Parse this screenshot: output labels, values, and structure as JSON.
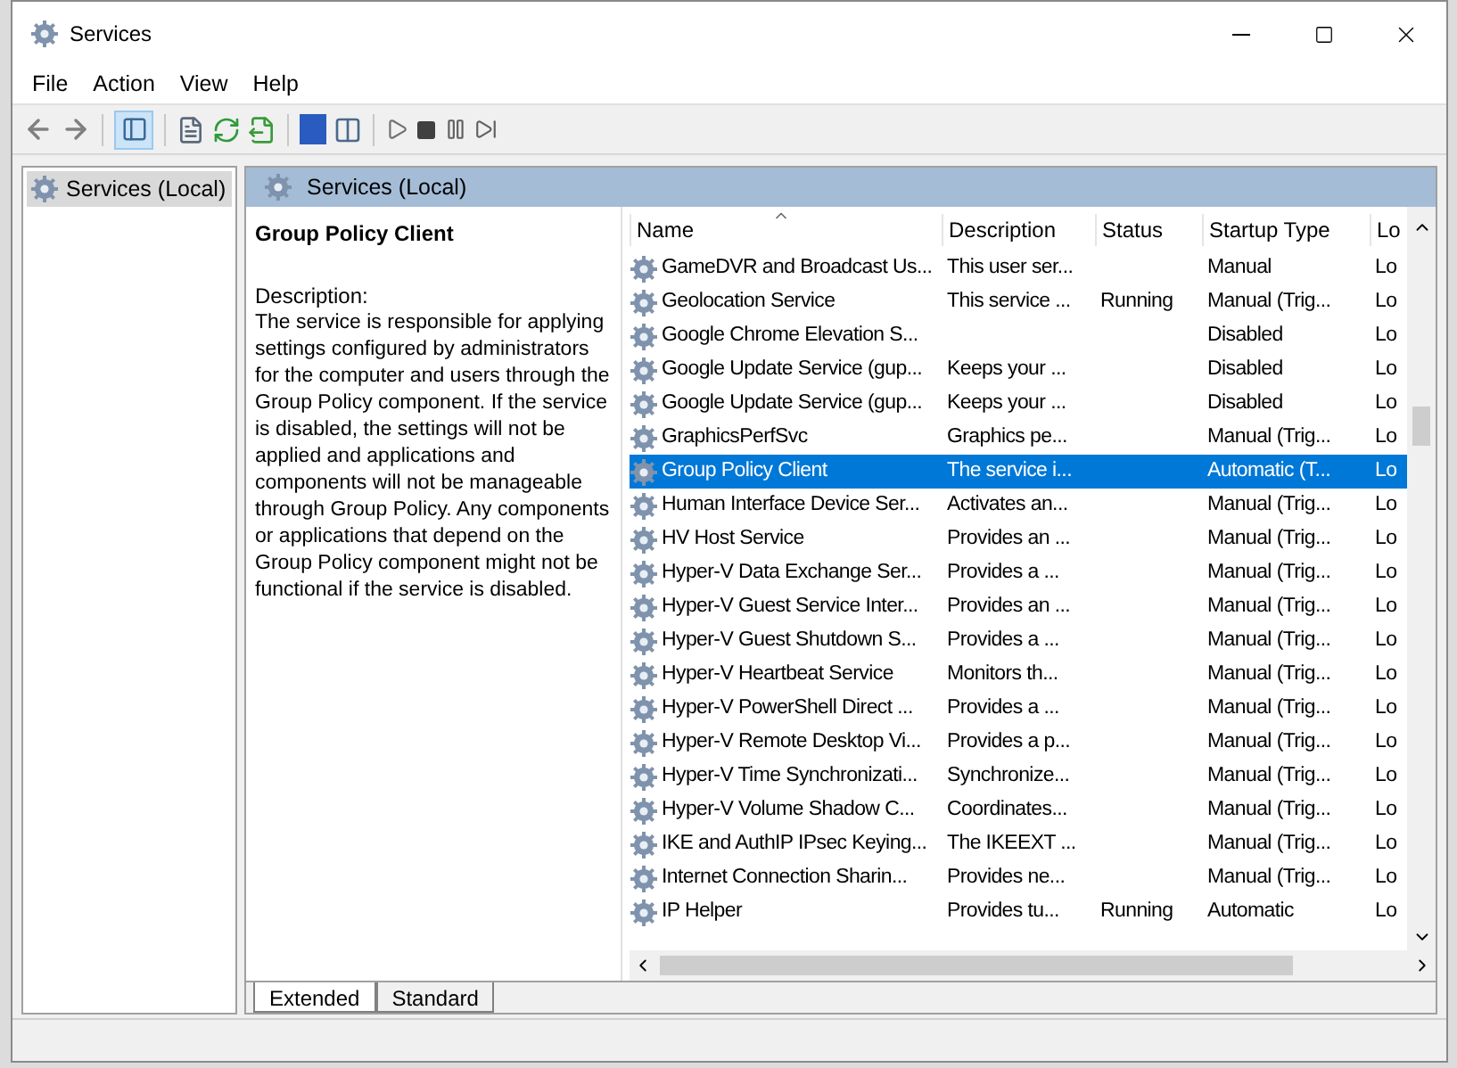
{
  "window": {
    "title": "Services"
  },
  "menu": [
    "File",
    "Action",
    "View",
    "Help"
  ],
  "tree": [
    {
      "label": "Services (Local)",
      "selected": true
    }
  ],
  "panel_header": "Services (Local)",
  "details": {
    "title": "Group Policy Client",
    "description_label": "Description:",
    "description": "The service is responsible for applying settings configured by administrators for the computer and users through the Group Policy component. If the service is disabled, the settings will not be applied and applications and components will not be manageable through Group Policy. Any components or applications that depend on the Group Policy component might not be functional if the service is disabled."
  },
  "table": {
    "columns": [
      "Name",
      "Description",
      "Status",
      "Startup Type",
      "Lo"
    ],
    "rows": [
      {
        "name": "GameDVR and Broadcast Us...",
        "description": "This user ser...",
        "status": "",
        "startup": "Manual",
        "log_on": "Lo",
        "selected": false
      },
      {
        "name": "Geolocation Service",
        "description": "This service ...",
        "status": "Running",
        "startup": "Manual (Trig...",
        "log_on": "Lo",
        "selected": false
      },
      {
        "name": "Google Chrome Elevation S...",
        "description": "",
        "status": "",
        "startup": "Disabled",
        "log_on": "Lo",
        "selected": false
      },
      {
        "name": "Google Update Service (gup...",
        "description": "Keeps your ...",
        "status": "",
        "startup": "Disabled",
        "log_on": "Lo",
        "selected": false
      },
      {
        "name": "Google Update Service (gup...",
        "description": "Keeps your ...",
        "status": "",
        "startup": "Disabled",
        "log_on": "Lo",
        "selected": false
      },
      {
        "name": "GraphicsPerfSvc",
        "description": "Graphics pe...",
        "status": "",
        "startup": "Manual (Trig...",
        "log_on": "Lo",
        "selected": false
      },
      {
        "name": "Group Policy Client",
        "description": "The service i...",
        "status": "",
        "startup": "Automatic (T...",
        "log_on": "Lo",
        "selected": true
      },
      {
        "name": "Human Interface Device Ser...",
        "description": "Activates an...",
        "status": "",
        "startup": "Manual (Trig...",
        "log_on": "Lo",
        "selected": false
      },
      {
        "name": "HV Host Service",
        "description": "Provides an ...",
        "status": "",
        "startup": "Manual (Trig...",
        "log_on": "Lo",
        "selected": false
      },
      {
        "name": "Hyper-V Data Exchange Ser...",
        "description": "Provides a ...",
        "status": "",
        "startup": "Manual (Trig...",
        "log_on": "Lo",
        "selected": false
      },
      {
        "name": "Hyper-V Guest Service Inter...",
        "description": "Provides an ...",
        "status": "",
        "startup": "Manual (Trig...",
        "log_on": "Lo",
        "selected": false
      },
      {
        "name": "Hyper-V Guest Shutdown S...",
        "description": "Provides a ...",
        "status": "",
        "startup": "Manual (Trig...",
        "log_on": "Lo",
        "selected": false
      },
      {
        "name": "Hyper-V Heartbeat Service",
        "description": "Monitors th...",
        "status": "",
        "startup": "Manual (Trig...",
        "log_on": "Lo",
        "selected": false
      },
      {
        "name": "Hyper-V PowerShell Direct ...",
        "description": "Provides a ...",
        "status": "",
        "startup": "Manual (Trig...",
        "log_on": "Lo",
        "selected": false
      },
      {
        "name": "Hyper-V Remote Desktop Vi...",
        "description": "Provides a p...",
        "status": "",
        "startup": "Manual (Trig...",
        "log_on": "Lo",
        "selected": false
      },
      {
        "name": "Hyper-V Time Synchronizati...",
        "description": "Synchronize...",
        "status": "",
        "startup": "Manual (Trig...",
        "log_on": "Lo",
        "selected": false
      },
      {
        "name": "Hyper-V Volume Shadow C...",
        "description": "Coordinates...",
        "status": "",
        "startup": "Manual (Trig...",
        "log_on": "Lo",
        "selected": false
      },
      {
        "name": "IKE and AuthIP IPsec Keying...",
        "description": "The IKEEXT ...",
        "status": "",
        "startup": "Manual (Trig...",
        "log_on": "Lo",
        "selected": false
      },
      {
        "name": "Internet Connection Sharin...",
        "description": "Provides ne...",
        "status": "",
        "startup": "Manual (Trig...",
        "log_on": "Lo",
        "selected": false
      },
      {
        "name": "IP Helper",
        "description": "Provides tu...",
        "status": "Running",
        "startup": "Automatic",
        "log_on": "Lo",
        "selected": false
      }
    ]
  },
  "view_tabs": [
    {
      "label": "Extended",
      "selected": true
    },
    {
      "label": "Standard",
      "selected": false
    }
  ]
}
